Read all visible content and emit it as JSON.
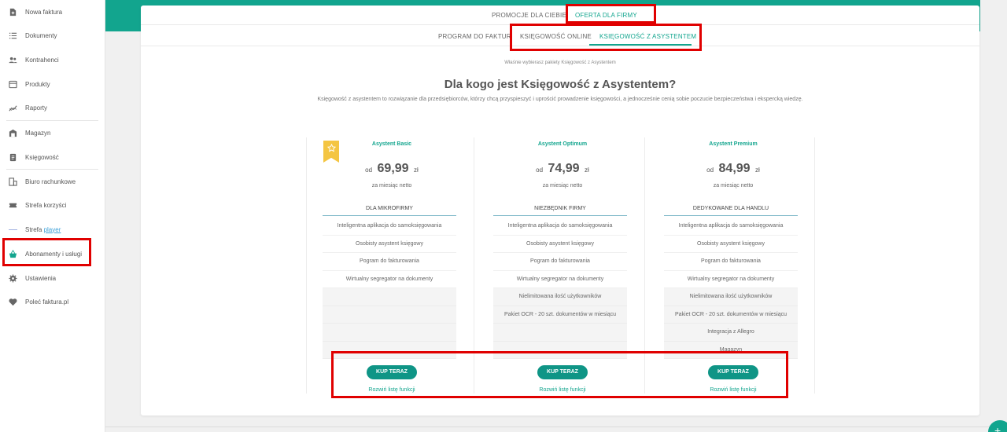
{
  "sidebar": {
    "items": [
      {
        "label": "Nowa faktura",
        "icon": "document-plus-icon"
      },
      {
        "label": "Dokumenty",
        "icon": "list-icon"
      },
      {
        "label": "Kontrahenci",
        "icon": "users-icon"
      },
      {
        "label": "Produkty",
        "icon": "store-icon"
      },
      {
        "label": "Raporty",
        "icon": "chart-line-icon"
      },
      {
        "label": "Magazyn",
        "icon": "warehouse-icon"
      },
      {
        "label": "Księgowość",
        "icon": "ledger-icon"
      },
      {
        "label": "Biuro rachunkowe",
        "icon": "building-icon"
      },
      {
        "label": "Strefa korzyści",
        "icon": "ticket-icon"
      },
      {
        "label": "Strefa",
        "label_suffix": "player",
        "icon": "line-icon"
      },
      {
        "label": "Abonamenty i usługi",
        "icon": "basket-icon"
      },
      {
        "label": "Ustawienia",
        "icon": "gear-icon"
      },
      {
        "label": "Poleć faktura.pl",
        "icon": "heart-icon"
      }
    ]
  },
  "tabs": {
    "row1": [
      {
        "label": "PROMOCJE DLA CIEBIE",
        "active": false
      },
      {
        "label": "OFERTA DLA FIRMY",
        "active": true
      }
    ],
    "row2": [
      {
        "label": "PROGRAM DO FAKTUR",
        "active": false
      },
      {
        "label": "KSIĘGOWOŚĆ ONLINE",
        "active": false
      },
      {
        "label": "KSIĘGOWOŚĆ Z ASYSTENTEM",
        "active": true
      }
    ]
  },
  "content": {
    "note": "Właśnie wybierasz pakiety Księgowość z Asystentem",
    "heading": "Dla kogo jest Księgowość z Asystentem?",
    "description": "Księgowość z asystentem to rozwiązanie dla przedsiębiorców, którzy chcą przyspieszyć i uprościć prowadzenie księgowości, a jednocześnie cenią sobie poczucie bezpieczeństwa i ekspercką wiedzę."
  },
  "plans": [
    {
      "name": "Asystent Basic",
      "price_prefix": "od",
      "price": "69,99",
      "currency": "zł",
      "period": "za miesiąc netto",
      "label": "DLA MIKROFIRMY",
      "features": [
        "Inteligentna aplikacja do samoksięgowania",
        "Osobisty asystent księgowy",
        "Pogram do fakturowania",
        "Wirtualny segregator na dokumenty"
      ],
      "buy_label": "KUP TERAZ",
      "expand_label": "Rozwiń listę funkcji"
    },
    {
      "name": "Asystent Optimum",
      "price_prefix": "od",
      "price": "74,99",
      "currency": "zł",
      "period": "za miesiąc netto",
      "label": "NIEZBĘDNIK FIRMY",
      "features": [
        "Inteligentna aplikacja do samoksięgowania",
        "Osobisty asystent księgowy",
        "Pogram do fakturowania",
        "Wirtualny segregator na dokumenty",
        "Nielimitowana ilość użytkowników",
        "Pakiet OCR - 20 szt. dokumentów w miesiącu"
      ],
      "buy_label": "KUP TERAZ",
      "expand_label": "Rozwiń listę funkcji"
    },
    {
      "name": "Asystent Premium",
      "price_prefix": "od",
      "price": "84,99",
      "currency": "zł",
      "period": "za miesiąc netto",
      "label": "DEDYKOWANE DLA HANDLU",
      "features": [
        "Inteligentna aplikacja do samoksięgowania",
        "Osobisty asystent księgowy",
        "Pogram do fakturowania",
        "Wirtualny segregator na dokumenty",
        "Nielimitowana ilość użytkowników",
        "Pakiet OCR - 20 szt. dokumentów w miesiącu",
        "Integracja z Allegro",
        "Magazyn"
      ],
      "buy_label": "KUP TERAZ",
      "expand_label": "Rozwiń listę funkcji"
    }
  ],
  "colors": {
    "accent": "#12a58e",
    "button": "#0f9586",
    "highlight": "#e00000",
    "star_badge": "#f4c542"
  }
}
